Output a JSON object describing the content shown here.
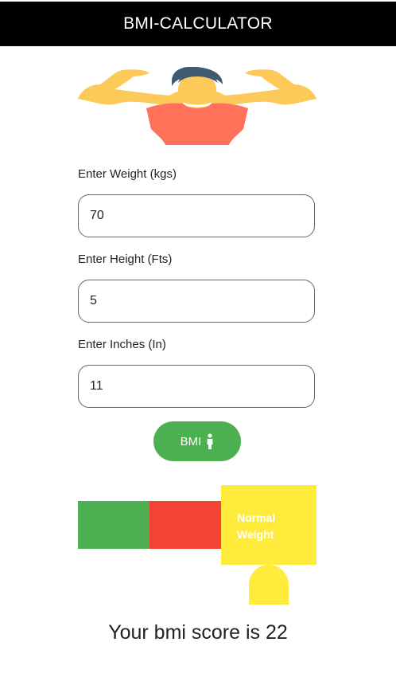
{
  "app": {
    "title": "BMI-CALCULATOR"
  },
  "form": {
    "weight": {
      "label": "Enter Weight (kgs)",
      "value": "70"
    },
    "height": {
      "label": "Enter Height (Fts)",
      "value": "5"
    },
    "inches": {
      "label": "Enter Inches (In)",
      "value": "11"
    }
  },
  "bmi_button": {
    "label": "BMI",
    "icon": "person-icon"
  },
  "scale": {
    "segments": [
      {
        "color": "#4caf50"
      },
      {
        "color": "#f44336"
      },
      {
        "color": "#ffeb3b",
        "label": "Normal Weight"
      }
    ]
  },
  "result": {
    "text": "Your bmi score is 22"
  },
  "colors": {
    "accent": "#4caf50",
    "header": "#000000",
    "warn": "#f44336",
    "highlight": "#ffeb3b"
  }
}
